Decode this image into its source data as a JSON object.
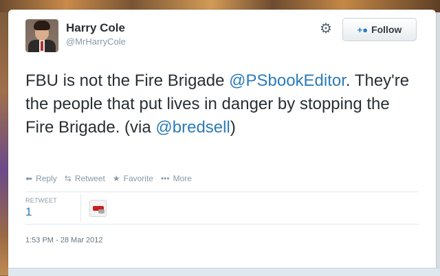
{
  "author": {
    "name": "Harry Cole",
    "handle": "@MrHarryCole"
  },
  "header": {
    "follow_label": "Follow",
    "gear_icon": "gear-icon",
    "follow_icon": "person-plus-icon"
  },
  "tweet": {
    "text_part1": "FBU is not the Fire Brigade ",
    "mention1": "@PSbookEditor",
    "text_part2": ". They're the people that put lives in danger by stopping the Fire Brigade. (via ",
    "mention2": "@bredsell",
    "text_part3": ")"
  },
  "actions": {
    "reply": "Reply",
    "retweet": "Retweet",
    "favorite": "Favorite",
    "more": "More"
  },
  "stats": {
    "retweet_label": "RETWEET",
    "retweet_count": "1"
  },
  "timestamp": "1:53 PM - 28 Mar 2012",
  "colors": {
    "link": "#2b7bb9",
    "text": "#292f33",
    "muted": "#8899a6"
  }
}
